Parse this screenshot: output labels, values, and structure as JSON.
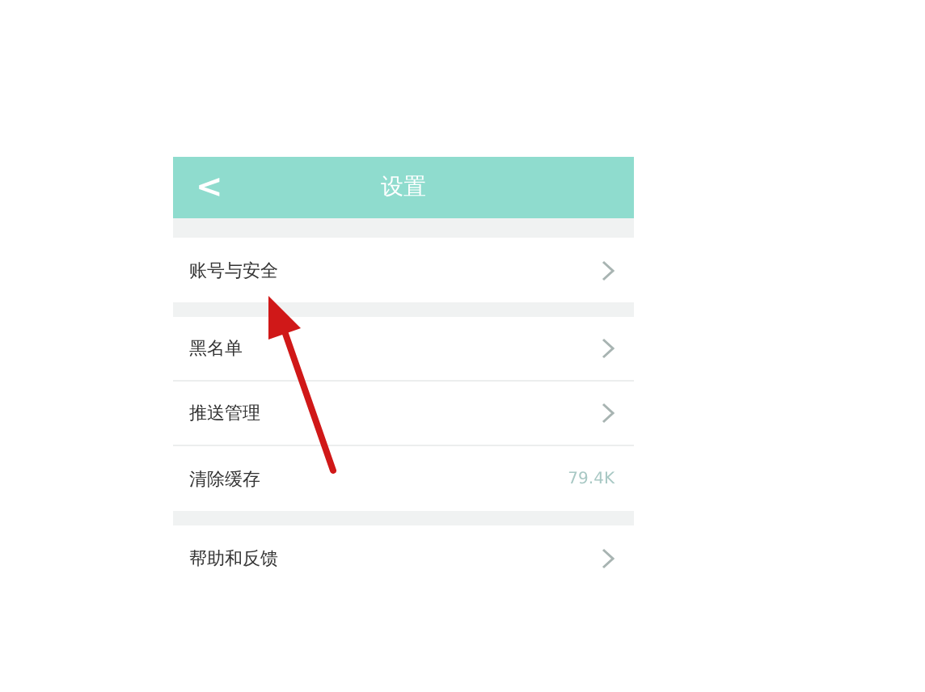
{
  "header": {
    "back": "<",
    "title": "设置"
  },
  "groups": [
    {
      "rows": [
        {
          "kind": "link",
          "label": "账号与安全"
        }
      ]
    },
    {
      "rows": [
        {
          "kind": "link",
          "label": "黑名单"
        },
        {
          "kind": "link",
          "label": "推送管理"
        },
        {
          "kind": "value",
          "label": "清除缓存",
          "value": "79.4K"
        }
      ]
    },
    {
      "rows": [
        {
          "kind": "link",
          "label": "帮助和反馈"
        }
      ]
    }
  ]
}
